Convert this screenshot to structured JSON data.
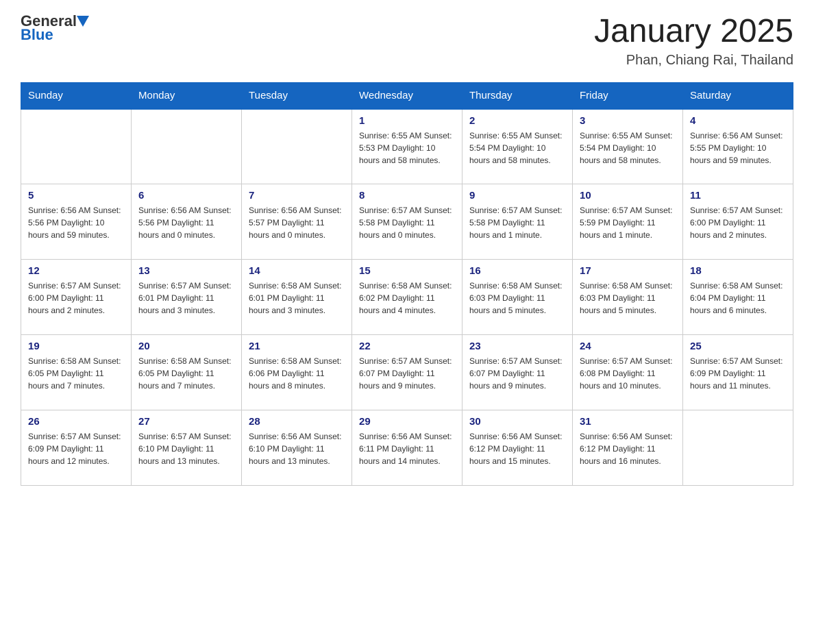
{
  "logo": {
    "general": "General",
    "blue": "Blue"
  },
  "title": "January 2025",
  "subtitle": "Phan, Chiang Rai, Thailand",
  "headers": [
    "Sunday",
    "Monday",
    "Tuesday",
    "Wednesday",
    "Thursday",
    "Friday",
    "Saturday"
  ],
  "weeks": [
    [
      {
        "day": "",
        "info": ""
      },
      {
        "day": "",
        "info": ""
      },
      {
        "day": "",
        "info": ""
      },
      {
        "day": "1",
        "info": "Sunrise: 6:55 AM\nSunset: 5:53 PM\nDaylight: 10 hours and 58 minutes."
      },
      {
        "day": "2",
        "info": "Sunrise: 6:55 AM\nSunset: 5:54 PM\nDaylight: 10 hours and 58 minutes."
      },
      {
        "day": "3",
        "info": "Sunrise: 6:55 AM\nSunset: 5:54 PM\nDaylight: 10 hours and 58 minutes."
      },
      {
        "day": "4",
        "info": "Sunrise: 6:56 AM\nSunset: 5:55 PM\nDaylight: 10 hours and 59 minutes."
      }
    ],
    [
      {
        "day": "5",
        "info": "Sunrise: 6:56 AM\nSunset: 5:56 PM\nDaylight: 10 hours and 59 minutes."
      },
      {
        "day": "6",
        "info": "Sunrise: 6:56 AM\nSunset: 5:56 PM\nDaylight: 11 hours and 0 minutes."
      },
      {
        "day": "7",
        "info": "Sunrise: 6:56 AM\nSunset: 5:57 PM\nDaylight: 11 hours and 0 minutes."
      },
      {
        "day": "8",
        "info": "Sunrise: 6:57 AM\nSunset: 5:58 PM\nDaylight: 11 hours and 0 minutes."
      },
      {
        "day": "9",
        "info": "Sunrise: 6:57 AM\nSunset: 5:58 PM\nDaylight: 11 hours and 1 minute."
      },
      {
        "day": "10",
        "info": "Sunrise: 6:57 AM\nSunset: 5:59 PM\nDaylight: 11 hours and 1 minute."
      },
      {
        "day": "11",
        "info": "Sunrise: 6:57 AM\nSunset: 6:00 PM\nDaylight: 11 hours and 2 minutes."
      }
    ],
    [
      {
        "day": "12",
        "info": "Sunrise: 6:57 AM\nSunset: 6:00 PM\nDaylight: 11 hours and 2 minutes."
      },
      {
        "day": "13",
        "info": "Sunrise: 6:57 AM\nSunset: 6:01 PM\nDaylight: 11 hours and 3 minutes."
      },
      {
        "day": "14",
        "info": "Sunrise: 6:58 AM\nSunset: 6:01 PM\nDaylight: 11 hours and 3 minutes."
      },
      {
        "day": "15",
        "info": "Sunrise: 6:58 AM\nSunset: 6:02 PM\nDaylight: 11 hours and 4 minutes."
      },
      {
        "day": "16",
        "info": "Sunrise: 6:58 AM\nSunset: 6:03 PM\nDaylight: 11 hours and 5 minutes."
      },
      {
        "day": "17",
        "info": "Sunrise: 6:58 AM\nSunset: 6:03 PM\nDaylight: 11 hours and 5 minutes."
      },
      {
        "day": "18",
        "info": "Sunrise: 6:58 AM\nSunset: 6:04 PM\nDaylight: 11 hours and 6 minutes."
      }
    ],
    [
      {
        "day": "19",
        "info": "Sunrise: 6:58 AM\nSunset: 6:05 PM\nDaylight: 11 hours and 7 minutes."
      },
      {
        "day": "20",
        "info": "Sunrise: 6:58 AM\nSunset: 6:05 PM\nDaylight: 11 hours and 7 minutes."
      },
      {
        "day": "21",
        "info": "Sunrise: 6:58 AM\nSunset: 6:06 PM\nDaylight: 11 hours and 8 minutes."
      },
      {
        "day": "22",
        "info": "Sunrise: 6:57 AM\nSunset: 6:07 PM\nDaylight: 11 hours and 9 minutes."
      },
      {
        "day": "23",
        "info": "Sunrise: 6:57 AM\nSunset: 6:07 PM\nDaylight: 11 hours and 9 minutes."
      },
      {
        "day": "24",
        "info": "Sunrise: 6:57 AM\nSunset: 6:08 PM\nDaylight: 11 hours and 10 minutes."
      },
      {
        "day": "25",
        "info": "Sunrise: 6:57 AM\nSunset: 6:09 PM\nDaylight: 11 hours and 11 minutes."
      }
    ],
    [
      {
        "day": "26",
        "info": "Sunrise: 6:57 AM\nSunset: 6:09 PM\nDaylight: 11 hours and 12 minutes."
      },
      {
        "day": "27",
        "info": "Sunrise: 6:57 AM\nSunset: 6:10 PM\nDaylight: 11 hours and 13 minutes."
      },
      {
        "day": "28",
        "info": "Sunrise: 6:56 AM\nSunset: 6:10 PM\nDaylight: 11 hours and 13 minutes."
      },
      {
        "day": "29",
        "info": "Sunrise: 6:56 AM\nSunset: 6:11 PM\nDaylight: 11 hours and 14 minutes."
      },
      {
        "day": "30",
        "info": "Sunrise: 6:56 AM\nSunset: 6:12 PM\nDaylight: 11 hours and 15 minutes."
      },
      {
        "day": "31",
        "info": "Sunrise: 6:56 AM\nSunset: 6:12 PM\nDaylight: 11 hours and 16 minutes."
      },
      {
        "day": "",
        "info": ""
      }
    ]
  ]
}
